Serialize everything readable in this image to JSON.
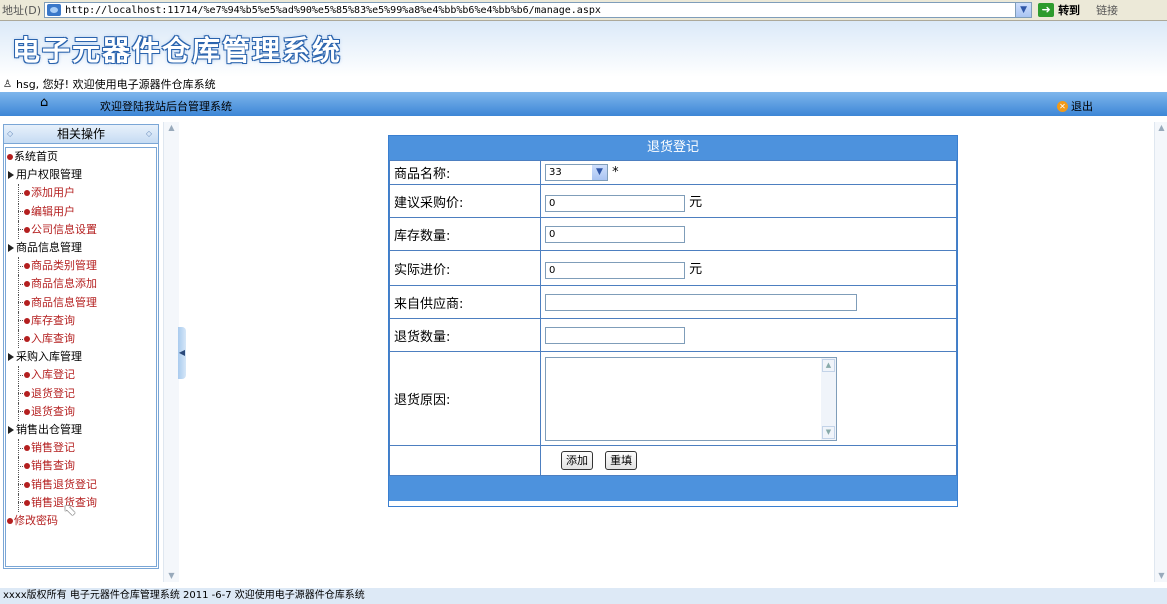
{
  "address_bar": {
    "label": "地址(D)",
    "url": "http://localhost:11714/%e7%94%b5%e5%ad%90%e5%85%83%e5%99%a8%e4%bb%b6%e4%bb%b6/manage.aspx",
    "go_label": "转到",
    "links_label": "链接"
  },
  "banner": {
    "title": "电子元器件仓库管理系统"
  },
  "userbar": {
    "text": "hsg, 您好! 欢迎使用电子源器件仓库系统"
  },
  "navbar": {
    "welcome": "欢迎登陆我站后台管理系统",
    "logout": "退出"
  },
  "sidebar": {
    "header": "相关操作",
    "items": [
      {
        "label": "系统首页",
        "type": "top"
      },
      {
        "label": "用户权限管理",
        "type": "group"
      },
      {
        "label": "添加用户",
        "type": "sub"
      },
      {
        "label": "编辑用户",
        "type": "sub"
      },
      {
        "label": "公司信息设置",
        "type": "sub"
      },
      {
        "label": "商品信息管理",
        "type": "group"
      },
      {
        "label": "商品类别管理",
        "type": "sub"
      },
      {
        "label": "商品信息添加",
        "type": "sub"
      },
      {
        "label": "商品信息管理",
        "type": "sub"
      },
      {
        "label": "库存查询",
        "type": "sub"
      },
      {
        "label": "入库查询",
        "type": "sub"
      },
      {
        "label": "采购入库管理",
        "type": "group"
      },
      {
        "label": "入库登记",
        "type": "sub"
      },
      {
        "label": "退货登记",
        "type": "sub"
      },
      {
        "label": "退货查询",
        "type": "sub"
      },
      {
        "label": "销售出仓管理",
        "type": "group"
      },
      {
        "label": "销售登记",
        "type": "sub"
      },
      {
        "label": "销售查询",
        "type": "sub"
      },
      {
        "label": "销售退货登记",
        "type": "sub"
      },
      {
        "label": "销售退货查询",
        "type": "sub"
      },
      {
        "label": "修改密码",
        "type": "top-red"
      }
    ]
  },
  "form": {
    "title": "退货登记",
    "product_name_label": "商品名称:",
    "product_name_value": "33",
    "required_mark": "*",
    "suggested_price_label": "建议采购价:",
    "suggested_price_value": "0",
    "unit_yuan": "元",
    "stock_label": "库存数量:",
    "stock_value": "0",
    "actual_price_label": "实际进价:",
    "actual_price_value": "0",
    "supplier_label": "来自供应商:",
    "supplier_value": "",
    "return_qty_label": "退货数量:",
    "return_qty_value": "",
    "reason_label": "退货原因:",
    "reason_value": "",
    "add_button": "添加",
    "reset_button": "重填"
  },
  "footer": {
    "text": "xxxx版权所有  电子元器件仓库管理系统  2011 -6-7  欢迎使用电子源器件仓库系统"
  }
}
